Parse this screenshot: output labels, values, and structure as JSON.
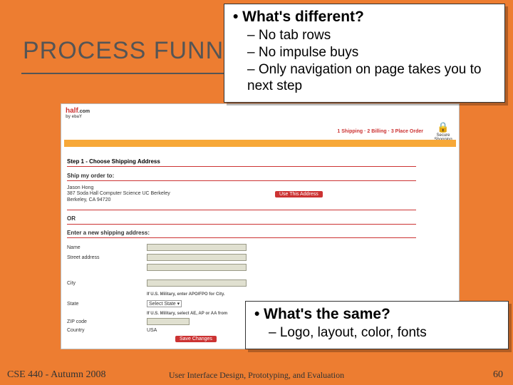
{
  "slide": {
    "title": "PROCESS FUNNEL",
    "footer_left": "CSE 440 - Autumn 2008",
    "footer_center": "User Interface Design, Prototyping, and Evaluation",
    "page_number": "60"
  },
  "overlay_top": {
    "lead": "• What's different?",
    "items": [
      "– No tab rows",
      "– No impulse buys",
      "– Only navigation on page takes you to next step"
    ]
  },
  "overlay_bottom": {
    "lead": "• What's the same?",
    "items": [
      "– Logo, layout, color, fonts"
    ]
  },
  "screenshot": {
    "logo_main": "half",
    "logo_suffix": ".com",
    "logo_byline": "by ebaY",
    "steps_text": "1 Shipping  ·  2 Billing  ·  3 Place Order",
    "secure_label": "Secure Shopping",
    "step_title": "Step 1 - Choose Shipping Address",
    "ship_to_label": "Ship my order to:",
    "address_name": "Jason Hong",
    "address_line1": "387 Soda Hall Computer Science UC Berkeley",
    "address_line2": "Berkeley, CA 94720",
    "use_address_btn": "Use This Address",
    "or_label": "OR",
    "enter_new_label": "Enter a new shipping address:",
    "fields": {
      "name": "Name",
      "street": "Street address",
      "city": "City",
      "state": "State",
      "state_note": "If U.S. Military, enter APO/FPO for City.",
      "state_select": "Select State",
      "zip": "ZIP code",
      "zip_note": "If U.S. Military, select AE, AP or AA from",
      "country": "Country",
      "country_value": "USA"
    },
    "save_btn": "Save Changes"
  }
}
